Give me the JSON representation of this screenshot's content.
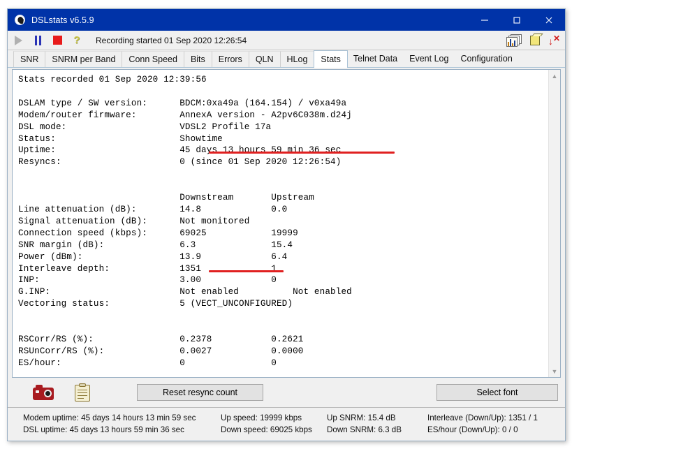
{
  "window": {
    "title": "DSLstats v6.5.9",
    "icon": "app-globe-icon",
    "minimize": "minimize-icon",
    "maximize": "maximize-icon",
    "close": "close-icon"
  },
  "toolbar": {
    "play": "play-icon",
    "pause": "pause-icon",
    "stop": "stop-icon",
    "help": "help-question-icon",
    "status_text": "Recording started 01 Sep 2020 12:26:54",
    "graphs_icon": "graphs-windows-icon",
    "cube_icon": "yellow-cube-icon",
    "exit_icon": "exit-down-arrow-icon"
  },
  "tabs": [
    {
      "label": "SNR",
      "active": false
    },
    {
      "label": "SNRM per Band",
      "active": false
    },
    {
      "label": "Conn Speed",
      "active": false
    },
    {
      "label": "Bits",
      "active": false
    },
    {
      "label": "Errors",
      "active": false
    },
    {
      "label": "QLN",
      "active": false
    },
    {
      "label": "HLog",
      "active": false
    },
    {
      "label": "Stats",
      "active": true
    },
    {
      "label": "Telnet Data",
      "active": false
    },
    {
      "label": "Event Log",
      "active": false
    },
    {
      "label": "Configuration",
      "active": false
    }
  ],
  "stats_text": "Stats recorded 01 Sep 2020 12:39:56\n\nDSLAM type / SW version:      BDCM:0xa49a (164.154) / v0xa49a\nModem/router firmware:        AnnexA version - A2pv6C038m.d24j\nDSL mode:                     VDSL2 Profile 17a\nStatus:                       Showtime\nUptime:                       45 days 13 hours 59 min 36 sec\nResyncs:                      0 (since 01 Sep 2020 12:26:54)\n\n\n                              Downstream       Upstream\nLine attenuation (dB):        14.8             0.0\nSignal attenuation (dB):      Not monitored\nConnection speed (kbps):      69025            19999\nSNR margin (dB):              6.3              15.4\nPower (dBm):                  13.9             6.4\nInterleave depth:             1351             1\nINP:                          3.00             0\nG.INP:                        Not enabled          Not enabled\nVectoring status:             5 (VECT_UNCONFIGURED)\n\n\nRSCorr/RS (%):                0.2378           0.2621\nRSUnCorr/RS (%):              0.0027           0.0000\nES/hour:                      0                0",
  "annotations": {
    "underline_color": "#e02020",
    "uptime_underline_text": "45 days 13 hours 59 min 36 sec",
    "ginp_underline_text": "Not enabled"
  },
  "scrollbar": {
    "up_arrow": "chevron-up-icon",
    "down_arrow": "chevron-down-icon"
  },
  "buttonbar": {
    "camera_icon": "camera-screenshot-icon",
    "clipboard_icon": "clipboard-copy-icon",
    "reset_label": "Reset resync count",
    "font_label": "Select font"
  },
  "statusbar": {
    "col1": {
      "line1": "Modem uptime: 45 days 14 hours 13 min 59 sec",
      "line2": "DSL uptime: 45 days 13 hours 59 min 36 sec"
    },
    "col2": {
      "line1": "Up speed: 19999 kbps",
      "line2": "Down speed: 69025 kbps"
    },
    "col3": {
      "line1": "Up SNRM: 15.4 dB",
      "line2": "Down SNRM: 6.3 dB"
    },
    "col4": {
      "line1": "Interleave (Down/Up): 1351 / 1",
      "line2": "ES/hour (Down/Up): 0 / 0"
    }
  }
}
